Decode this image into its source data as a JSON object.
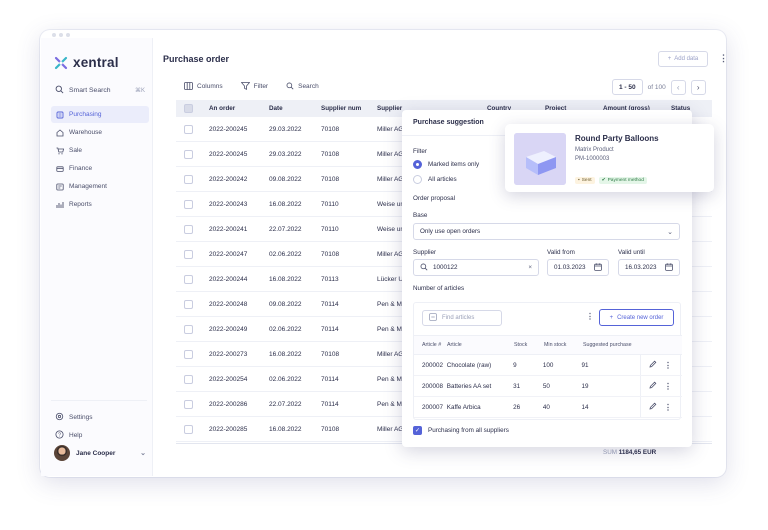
{
  "app": {
    "name": "xentral",
    "brand_color": "#5563d8"
  },
  "sidebar": {
    "search_label": "Smart Search",
    "search_shortcut": "⌘K",
    "items": [
      {
        "label": "Purchasing",
        "icon": "purchasing-icon",
        "active": true
      },
      {
        "label": "Warehouse",
        "icon": "warehouse-icon"
      },
      {
        "label": "Sale",
        "icon": "cart-icon"
      },
      {
        "label": "Finance",
        "icon": "finance-icon"
      },
      {
        "label": "Management",
        "icon": "management-icon"
      },
      {
        "label": "Reports",
        "icon": "reports-icon"
      }
    ],
    "settings_label": "Settings",
    "help_label": "Help",
    "user_name": "Jane Cooper"
  },
  "header": {
    "title": "Purchase order",
    "add_label": "Add data"
  },
  "toolbar": {
    "columns": "Columns",
    "filter": "Filter",
    "search": "Search"
  },
  "pager": {
    "range": "1 - 50",
    "of": "of 100"
  },
  "table": {
    "headers": [
      "An order",
      "Date",
      "Supplier num",
      "Supplier",
      "Country",
      "Project",
      "Amount (gross)",
      "Status"
    ],
    "rows": [
      {
        "order": "2022-200245",
        "date": "29.03.2022",
        "supplier_num": "70108",
        "supplier": "Miller AG"
      },
      {
        "order": "2022-200245",
        "date": "29.03.2022",
        "supplier_num": "70108",
        "supplier": "Miller AG"
      },
      {
        "order": "2022-200242",
        "date": "09.08.2022",
        "supplier_num": "70108",
        "supplier": "Miller AG"
      },
      {
        "order": "2022-200243",
        "date": "16.08.2022",
        "supplier_num": "70110",
        "supplier": "Weise und"
      },
      {
        "order": "2022-200241",
        "date": "22.07.2022",
        "supplier_num": "70110",
        "supplier": "Weise und"
      },
      {
        "order": "2022-200247",
        "date": "02.06.2022",
        "supplier_num": "70108",
        "supplier": "Miller AG"
      },
      {
        "order": "2022-200244",
        "date": "16.08.2022",
        "supplier_num": "70113",
        "supplier": "Lücker U"
      },
      {
        "order": "2022-200248",
        "date": "09.08.2022",
        "supplier_num": "70114",
        "supplier": "Pen & Mo"
      },
      {
        "order": "2022-200249",
        "date": "02.06.2022",
        "supplier_num": "70114",
        "supplier": "Pen & Mo"
      },
      {
        "order": "2022-200273",
        "date": "16.08.2022",
        "supplier_num": "70108",
        "supplier": "Miller AG"
      },
      {
        "order": "2022-200254",
        "date": "02.06.2022",
        "supplier_num": "70114",
        "supplier": "Pen & Mo"
      },
      {
        "order": "2022-200286",
        "date": "22.07.2022",
        "supplier_num": "70114",
        "supplier": "Pen & Mo"
      },
      {
        "order": "2022-200285",
        "date": "16.08.2022",
        "supplier_num": "70108",
        "supplier": "Miller AG"
      }
    ],
    "sum": "SUM 1184,65 EUR"
  },
  "modal": {
    "title": "Purchase suggestion",
    "filter_label": "Filter",
    "radio_marked": "Marked items only",
    "radio_all": "All articles",
    "order_proposal": "Order proposal",
    "base_label": "Base",
    "base_value": "Only use open orders",
    "supplier_label": "Supplier",
    "supplier_value": "1000122",
    "valid_from_label": "Valid from",
    "valid_from_value": "01.03.2023",
    "valid_until_label": "Valid until",
    "valid_until_value": "16.03.2023",
    "articles_label": "Number of articles",
    "find_placeholder": "Find articles",
    "create_label": "Create new order",
    "article_headers": [
      "Article #",
      "Article",
      "Stock",
      "Min stock",
      "Suggested purchase"
    ],
    "articles": [
      {
        "num": "200002",
        "name": "Chocolate (raw)",
        "stock": "9",
        "min": "100",
        "suggested": "91"
      },
      {
        "num": "200008",
        "name": "Batteries AA set",
        "stock": "31",
        "min": "50",
        "suggested": "19"
      },
      {
        "num": "200007",
        "name": "Kaffe Arbica",
        "stock": "26",
        "min": "40",
        "suggested": "14"
      }
    ],
    "all_suppliers_label": "Purchasing from all suppliers"
  },
  "product_card": {
    "title": "Round Party Balloons",
    "type": "Matrix Product",
    "pm": "PM-1000003",
    "badge_sent": "Sent",
    "badge_payment": "Payment method"
  }
}
